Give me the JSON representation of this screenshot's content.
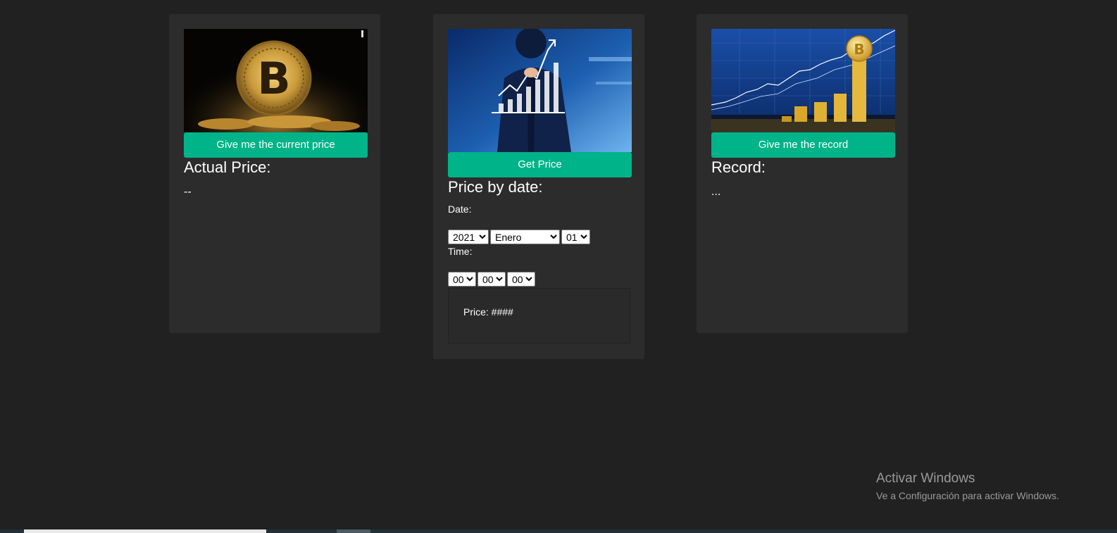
{
  "current_price_card": {
    "button_label": "Give me the current price",
    "heading": "Actual Price:",
    "value": "--"
  },
  "price_by_date_card": {
    "button_label": "Get Price",
    "heading": "Price by date:",
    "date_label": "Date:",
    "time_label": "Time:",
    "year": "2021",
    "month": "Enero",
    "day": "01",
    "hour": "00",
    "minute": "00",
    "second": "00",
    "price_text": "Price: ####"
  },
  "record_card": {
    "button_label": "Give me the record",
    "heading": "Record:",
    "value": "..."
  },
  "watermark": {
    "title": "Activar Windows",
    "subtitle": "Ve a Configuración para activar Windows."
  },
  "colors": {
    "background": "#212121",
    "card": "#2c2c2c",
    "accent": "#00b388"
  }
}
